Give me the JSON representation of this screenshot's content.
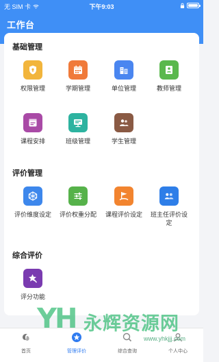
{
  "status_bar": {
    "carrier": "无 SIM 卡",
    "time": "下午9:03"
  },
  "header": {
    "title": "工作台",
    "color": "#3f8ff6"
  },
  "sections": [
    {
      "title": "基础管理",
      "items": [
        {
          "label": "权限管理",
          "icon": "shield-icon",
          "color": "#f2b53c"
        },
        {
          "label": "学期管理",
          "icon": "calendar-icon",
          "color": "#f07a3a"
        },
        {
          "label": "单位管理",
          "icon": "building-icon",
          "color": "#4a86f0"
        },
        {
          "label": "教师管理",
          "icon": "teacher-icon",
          "color": "#5ab84d"
        },
        {
          "label": "课程安排",
          "icon": "course-icon",
          "color": "#a94aa6"
        },
        {
          "label": "班级管理",
          "icon": "classroom-icon",
          "color": "#2db3a0"
        },
        {
          "label": "学生管理",
          "icon": "students-icon",
          "color": "#8a5a44"
        }
      ]
    },
    {
      "title": "评价管理",
      "items": [
        {
          "label": "评价维度设定",
          "icon": "dimension-icon",
          "color": "#3d87ec"
        },
        {
          "label": "评价权重分配",
          "icon": "sliders-icon",
          "color": "#56b24a"
        },
        {
          "label": "课程评价设定",
          "icon": "flag-icon",
          "color": "#f2842f"
        },
        {
          "label": "班主任评价设定",
          "icon": "people-icon",
          "color": "#2e7ee8"
        }
      ]
    },
    {
      "title": "综合评价",
      "items": [
        {
          "label": "评分功能",
          "icon": "star-icon",
          "color": "#7a3bb0"
        }
      ]
    }
  ],
  "tabbar": {
    "items": [
      {
        "label": "首页",
        "icon": "home-icon",
        "active": false
      },
      {
        "label": "管理评价",
        "icon": "star-tab-icon",
        "active": true
      },
      {
        "label": "综合查询",
        "icon": "query-icon",
        "active": false
      },
      {
        "label": "个人中心",
        "icon": "user-icon",
        "active": false
      }
    ],
    "active_color": "#2f7bf0"
  },
  "watermark": {
    "text": "永辉资源网",
    "url": "www.yhkjjj.com"
  }
}
